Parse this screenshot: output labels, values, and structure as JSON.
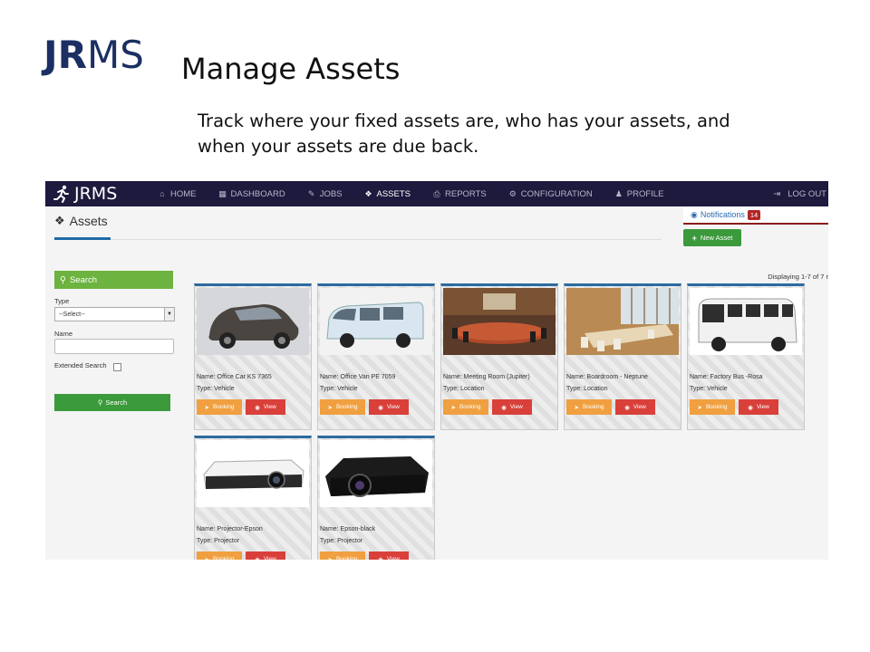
{
  "slide": {
    "logo_bold": "JR",
    "logo_thin": "MS",
    "title": "Manage Assets",
    "description": "Track where your fixed assets are, who has your assets, and when your assets are due back."
  },
  "app": {
    "brand": "JRMS",
    "nav": [
      {
        "label": "HOME",
        "icon": "home-icon",
        "glyph": "⌂"
      },
      {
        "label": "DASHBOARD",
        "icon": "grid-icon",
        "glyph": "▦"
      },
      {
        "label": "JOBS",
        "icon": "wrench-icon",
        "glyph": "✎"
      },
      {
        "label": "ASSETS",
        "icon": "cubes-icon",
        "glyph": "❖"
      },
      {
        "label": "REPORTS",
        "icon": "print-icon",
        "glyph": "⎙"
      },
      {
        "label": "CONFIGURATION",
        "icon": "cogs-icon",
        "glyph": "⚙"
      },
      {
        "label": "PROFILE",
        "icon": "user-icon",
        "glyph": "♟"
      }
    ],
    "logout": "LOG OUT",
    "page_title": "Assets",
    "notifications_label": "Notifications",
    "notifications_count": "14",
    "new_asset_label": "New Asset",
    "display_count": "Displaying 1-7 of 7 r",
    "sidebar": {
      "search_title": "Search",
      "type_label": "Type",
      "type_value": "--Select--",
      "name_label": "Name",
      "extended_label": "Extended Search",
      "search_button": "Search"
    },
    "assets": [
      {
        "name": "Name: Office Car KS 7365",
        "type": "Type: Vehicle",
        "picture": "car"
      },
      {
        "name": "Name: Office Van PE 7059",
        "type": "Type: Vehicle",
        "picture": "van"
      },
      {
        "name": "Name: Meeting Room (Jupiter)",
        "type": "Type: Location",
        "picture": "meeting-room"
      },
      {
        "name": "Name: Boardroom - Neptune",
        "type": "Type: Location",
        "picture": "boardroom"
      },
      {
        "name": "Name: Factory Bus -Rosa",
        "type": "Type: Vehicle",
        "picture": "bus"
      },
      {
        "name": "Name: Projector-Epson",
        "type": "Type: Projector",
        "picture": "projector-white"
      },
      {
        "name": "Name: Epson-black",
        "type": "Type: Projector",
        "picture": "projector-black"
      }
    ],
    "booking_label": "Booking",
    "view_label": "View"
  }
}
